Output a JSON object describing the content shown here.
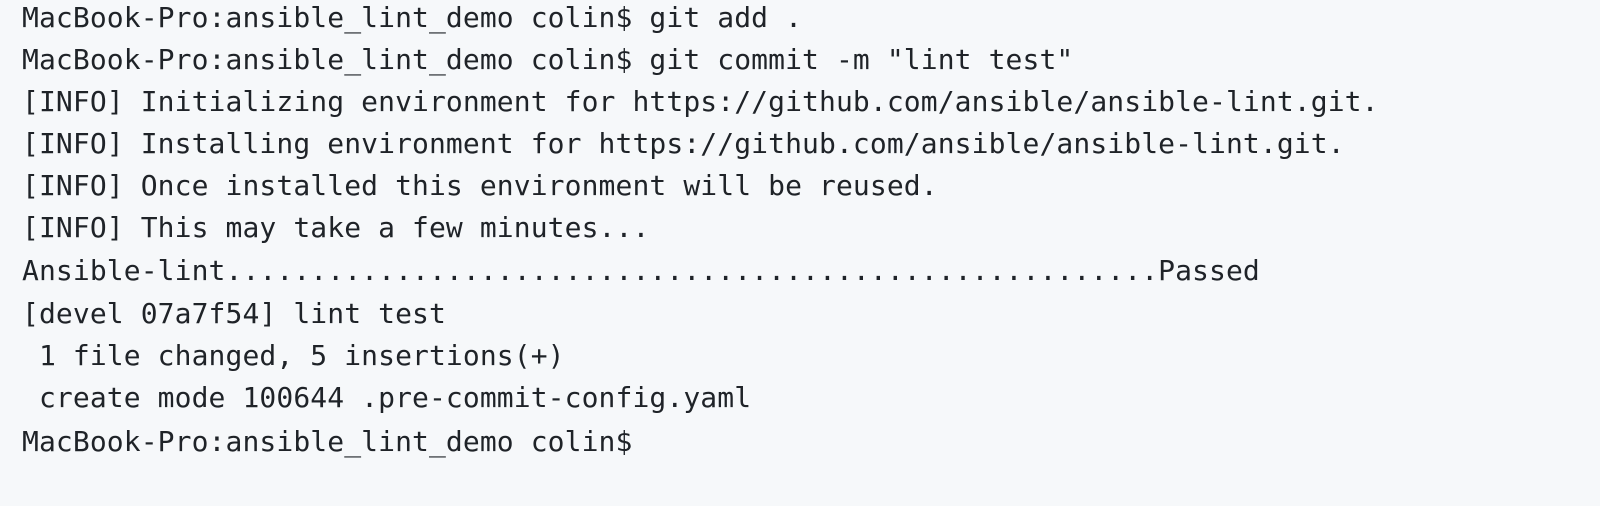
{
  "terminal": {
    "lines": [
      "MacBook-Pro:ansible_lint_demo colin$ git add .",
      "MacBook-Pro:ansible_lint_demo colin$ git commit -m \"lint test\"",
      "[INFO] Initializing environment for https://github.com/ansible/ansible-lint.git.",
      "[INFO] Installing environment for https://github.com/ansible/ansible-lint.git.",
      "[INFO] Once installed this environment will be reused.",
      "[INFO] This may take a few minutes...",
      "Ansible-lint.......................................................Passed",
      "[devel 07a7f54] lint test",
      " 1 file changed, 5 insertions(+)",
      " create mode 100644 .pre-commit-config.yaml",
      "MacBook-Pro:ansible_lint_demo colin$"
    ]
  }
}
